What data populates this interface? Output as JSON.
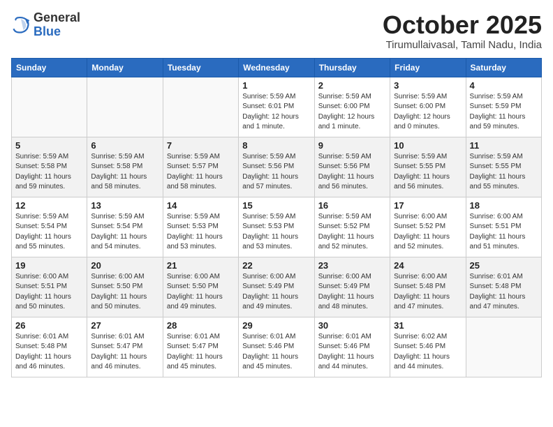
{
  "header": {
    "logo_general": "General",
    "logo_blue": "Blue",
    "month": "October 2025",
    "location": "Tirumullaivasal, Tamil Nadu, India"
  },
  "weekdays": [
    "Sunday",
    "Monday",
    "Tuesday",
    "Wednesday",
    "Thursday",
    "Friday",
    "Saturday"
  ],
  "weeks": [
    [
      {
        "num": "",
        "detail": ""
      },
      {
        "num": "",
        "detail": ""
      },
      {
        "num": "",
        "detail": ""
      },
      {
        "num": "1",
        "detail": "Sunrise: 5:59 AM\nSunset: 6:01 PM\nDaylight: 12 hours\nand 1 minute."
      },
      {
        "num": "2",
        "detail": "Sunrise: 5:59 AM\nSunset: 6:00 PM\nDaylight: 12 hours\nand 1 minute."
      },
      {
        "num": "3",
        "detail": "Sunrise: 5:59 AM\nSunset: 6:00 PM\nDaylight: 12 hours\nand 0 minutes."
      },
      {
        "num": "4",
        "detail": "Sunrise: 5:59 AM\nSunset: 5:59 PM\nDaylight: 11 hours\nand 59 minutes."
      }
    ],
    [
      {
        "num": "5",
        "detail": "Sunrise: 5:59 AM\nSunset: 5:58 PM\nDaylight: 11 hours\nand 59 minutes."
      },
      {
        "num": "6",
        "detail": "Sunrise: 5:59 AM\nSunset: 5:58 PM\nDaylight: 11 hours\nand 58 minutes."
      },
      {
        "num": "7",
        "detail": "Sunrise: 5:59 AM\nSunset: 5:57 PM\nDaylight: 11 hours\nand 58 minutes."
      },
      {
        "num": "8",
        "detail": "Sunrise: 5:59 AM\nSunset: 5:56 PM\nDaylight: 11 hours\nand 57 minutes."
      },
      {
        "num": "9",
        "detail": "Sunrise: 5:59 AM\nSunset: 5:56 PM\nDaylight: 11 hours\nand 56 minutes."
      },
      {
        "num": "10",
        "detail": "Sunrise: 5:59 AM\nSunset: 5:55 PM\nDaylight: 11 hours\nand 56 minutes."
      },
      {
        "num": "11",
        "detail": "Sunrise: 5:59 AM\nSunset: 5:55 PM\nDaylight: 11 hours\nand 55 minutes."
      }
    ],
    [
      {
        "num": "12",
        "detail": "Sunrise: 5:59 AM\nSunset: 5:54 PM\nDaylight: 11 hours\nand 55 minutes."
      },
      {
        "num": "13",
        "detail": "Sunrise: 5:59 AM\nSunset: 5:54 PM\nDaylight: 11 hours\nand 54 minutes."
      },
      {
        "num": "14",
        "detail": "Sunrise: 5:59 AM\nSunset: 5:53 PM\nDaylight: 11 hours\nand 53 minutes."
      },
      {
        "num": "15",
        "detail": "Sunrise: 5:59 AM\nSunset: 5:53 PM\nDaylight: 11 hours\nand 53 minutes."
      },
      {
        "num": "16",
        "detail": "Sunrise: 5:59 AM\nSunset: 5:52 PM\nDaylight: 11 hours\nand 52 minutes."
      },
      {
        "num": "17",
        "detail": "Sunrise: 6:00 AM\nSunset: 5:52 PM\nDaylight: 11 hours\nand 52 minutes."
      },
      {
        "num": "18",
        "detail": "Sunrise: 6:00 AM\nSunset: 5:51 PM\nDaylight: 11 hours\nand 51 minutes."
      }
    ],
    [
      {
        "num": "19",
        "detail": "Sunrise: 6:00 AM\nSunset: 5:51 PM\nDaylight: 11 hours\nand 50 minutes."
      },
      {
        "num": "20",
        "detail": "Sunrise: 6:00 AM\nSunset: 5:50 PM\nDaylight: 11 hours\nand 50 minutes."
      },
      {
        "num": "21",
        "detail": "Sunrise: 6:00 AM\nSunset: 5:50 PM\nDaylight: 11 hours\nand 49 minutes."
      },
      {
        "num": "22",
        "detail": "Sunrise: 6:00 AM\nSunset: 5:49 PM\nDaylight: 11 hours\nand 49 minutes."
      },
      {
        "num": "23",
        "detail": "Sunrise: 6:00 AM\nSunset: 5:49 PM\nDaylight: 11 hours\nand 48 minutes."
      },
      {
        "num": "24",
        "detail": "Sunrise: 6:00 AM\nSunset: 5:48 PM\nDaylight: 11 hours\nand 47 minutes."
      },
      {
        "num": "25",
        "detail": "Sunrise: 6:01 AM\nSunset: 5:48 PM\nDaylight: 11 hours\nand 47 minutes."
      }
    ],
    [
      {
        "num": "26",
        "detail": "Sunrise: 6:01 AM\nSunset: 5:48 PM\nDaylight: 11 hours\nand 46 minutes."
      },
      {
        "num": "27",
        "detail": "Sunrise: 6:01 AM\nSunset: 5:47 PM\nDaylight: 11 hours\nand 46 minutes."
      },
      {
        "num": "28",
        "detail": "Sunrise: 6:01 AM\nSunset: 5:47 PM\nDaylight: 11 hours\nand 45 minutes."
      },
      {
        "num": "29",
        "detail": "Sunrise: 6:01 AM\nSunset: 5:46 PM\nDaylight: 11 hours\nand 45 minutes."
      },
      {
        "num": "30",
        "detail": "Sunrise: 6:01 AM\nSunset: 5:46 PM\nDaylight: 11 hours\nand 44 minutes."
      },
      {
        "num": "31",
        "detail": "Sunrise: 6:02 AM\nSunset: 5:46 PM\nDaylight: 11 hours\nand 44 minutes."
      },
      {
        "num": "",
        "detail": ""
      }
    ]
  ],
  "shaded_rows": [
    1,
    3
  ]
}
